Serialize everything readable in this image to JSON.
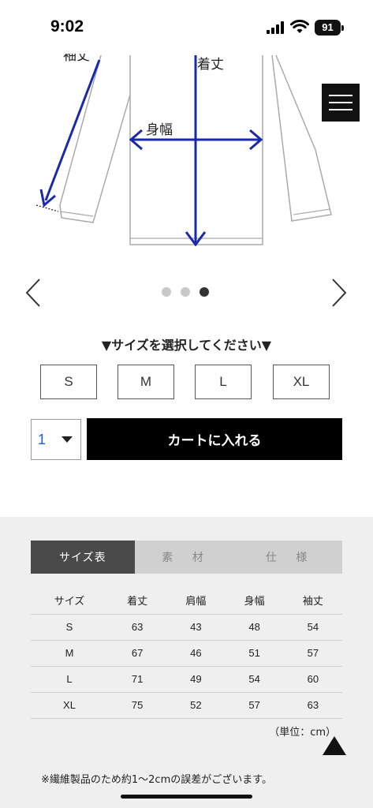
{
  "status_bar": {
    "time": "9:02",
    "battery": "91",
    "icons": [
      "signal-icon",
      "wifi-icon",
      "battery-icon"
    ]
  },
  "illustration": {
    "labels": {
      "sleeve": "袖丈",
      "length": "着丈",
      "body_width": "身幅"
    },
    "arrow_color": "#1a2aa8"
  },
  "menu": {
    "icon": "hamburger-menu-icon"
  },
  "carousel": {
    "prev_icon": "chevron-left-icon",
    "next_icon": "chevron-right-icon",
    "dot_count": 3,
    "active_dot": 3
  },
  "size_select": {
    "prompt": "▼サイズを選択してください▼",
    "options": [
      "S",
      "M",
      "L",
      "XL"
    ]
  },
  "purchase": {
    "quantity": "1",
    "cart_label": "カートに入れる"
  },
  "info_tabs": {
    "tabs": [
      "サイズ表",
      "素 材",
      "仕 様"
    ],
    "active": "サイズ表"
  },
  "size_table": {
    "headers": [
      "サイズ",
      "着丈",
      "肩幅",
      "身幅",
      "袖丈"
    ],
    "rows": [
      [
        "S",
        "63",
        "43",
        "48",
        "54"
      ],
      [
        "M",
        "67",
        "46",
        "51",
        "57"
      ],
      [
        "L",
        "71",
        "49",
        "54",
        "60"
      ],
      [
        "XL",
        "75",
        "52",
        "57",
        "63"
      ]
    ],
    "unit_note": "（単位：cm）"
  },
  "footnote": "※繊維製品のため約1〜2cmの誤差がございます。",
  "colors": {
    "accent_dark": "#000000",
    "panel_bg": "#efefef",
    "tab_active": "#4a4a4a",
    "quantity_text": "#1a5fd0"
  }
}
